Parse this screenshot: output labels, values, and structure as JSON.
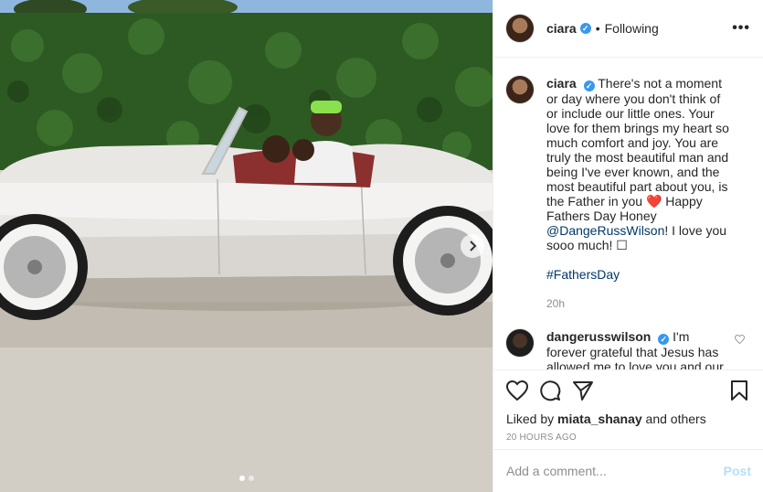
{
  "post": {
    "username": "ciara",
    "verified_mark": "✓",
    "dot": "•",
    "follow_status": "Following",
    "more_icon": "•••"
  },
  "caption": {
    "username": "ciara",
    "text_1": "There's not a moment or day where you don't think of or include our little ones. Your love for them brings my heart so much comfort and joy. You are truly the most beautiful man and being I've ever known, and the most beautiful part about you, is the Father in you ",
    "heart": "❤️",
    "text_2": " Happy Fathers Day Honey ",
    "mention": "@DangeRussWilson",
    "text_3": "! I love you sooo much! ☐",
    "hashtag": "#FathersDay",
    "time": "20h"
  },
  "comment": {
    "username": "dangerusswilson",
    "text": "I'm forever grateful that Jesus has allowed me to love you and our beautiful, intelligent, and kind"
  },
  "likes": {
    "prefix": "Liked by ",
    "user": "miata_shanay",
    "suffix": " and others"
  },
  "timestamp": "20 HOURS AGO",
  "add_comment": {
    "placeholder": "Add a comment...",
    "post_label": "Post"
  },
  "icons": [
    "heart-icon",
    "comment-icon",
    "share-icon",
    "bookmark-icon",
    "more-icon",
    "chevron-right-icon"
  ],
  "colors": {
    "link": "#00376b",
    "verified": "#3897f0",
    "post_disabled": "#b2dffc",
    "muted": "#8e8e8e"
  }
}
